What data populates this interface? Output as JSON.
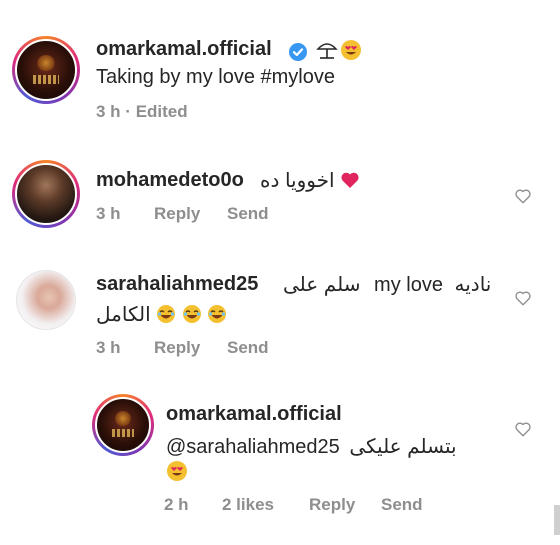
{
  "post": {
    "username": "omarkamal.official",
    "caption": "Taking by my love #mylove",
    "time": "3 h",
    "edited": "Edited",
    "separator": "·",
    "verified_icon": "verified-badge-icon",
    "emojis": [
      "beach-umbrella-icon",
      "heart-eyes-emoji-icon"
    ]
  },
  "comments": [
    {
      "username": "mohamedeto0o",
      "text": "اخوويا ده",
      "emoji": "red-heart-emoji-icon",
      "time": "3 h",
      "reply": "Reply",
      "send": "Send"
    },
    {
      "username": "sarahaliahmed25",
      "text_line1_rtl1": "ناديه",
      "text_line1_ltr": "my love",
      "text_line1_rtl2": "سلم على",
      "text_line2": "الكامل",
      "emoji": "laughing-emoji-icon",
      "time": "3 h",
      "reply": "Reply",
      "send": "Send"
    }
  ],
  "reply": {
    "username": "omarkamal.official",
    "mention": "@sarahaliahmed25",
    "text": "بتسلم عليكى",
    "emoji": "heart-eyes-emoji-icon",
    "time": "2 h",
    "likes": "2 likes",
    "reply": "Reply",
    "send": "Send"
  },
  "colors": {
    "text": "#262626",
    "meta": "#8e8e8e",
    "verified": "#3897f0",
    "heart_emoji": "#e0245e",
    "emoji_yellow": "#f5c030"
  }
}
